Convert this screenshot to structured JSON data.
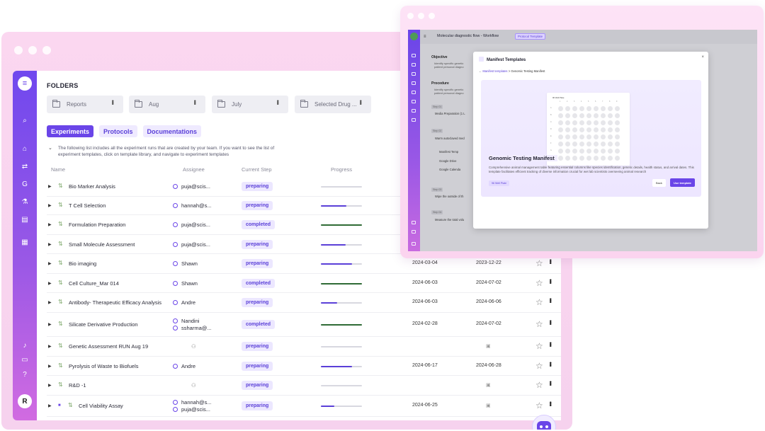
{
  "main": {
    "folders_title": "FOLDERS",
    "folders": [
      "Reports",
      "Aug",
      "July",
      "Selected Drug ..."
    ],
    "tabs": [
      "Experiments",
      "Protocols",
      "Documentations"
    ],
    "info_text": "The following list includes all the experiment runs that are created by your team. If you want to see the list of experiment templates, click on template library, and navigate to experiment templates",
    "columns": {
      "name": "Name",
      "assignee": "Assignee",
      "current_step": "Current Step",
      "progress": "Progress"
    },
    "rows": [
      {
        "name": "Bio Marker Analysis",
        "assignee": "puja@scis...",
        "step": "preparing",
        "progress": 0,
        "d1": "",
        "d2": ""
      },
      {
        "name": "T Cell Selection",
        "assignee": "hannah@s...",
        "step": "preparing",
        "progress": 0.62,
        "d1": "",
        "d2": ""
      },
      {
        "name": "Formulation Preparation",
        "assignee": "puja@scis...",
        "step": "completed",
        "progress": 1,
        "d1": "",
        "d2": ""
      },
      {
        "name": "Small Molecule Assessment",
        "assignee": "puja@scis...",
        "step": "preparing",
        "progress": 0.6,
        "d1": "",
        "d2": ""
      },
      {
        "name": "Bio imaging",
        "assignee": "Shawn",
        "step": "preparing",
        "progress": 0.75,
        "d1": "2024-03-04",
        "d2": "2023-12-22"
      },
      {
        "name": "Cell Culture_Mar 014",
        "assignee": "Shawn",
        "step": "completed",
        "progress": 1,
        "d1": "2024-06-03",
        "d2": "2024-07-02"
      },
      {
        "name": "Antibody- Therapeutic Efficacy Analysis",
        "assignee": "Andre",
        "step": "preparing",
        "progress": 0.4,
        "d1": "2024-06-03",
        "d2": "2024-06-06"
      },
      {
        "name": "Silicate Derivative Production",
        "assignee": "Nandini",
        "assignee2": "ssharma@...",
        "step": "completed",
        "progress": 1,
        "d1": "2024-02-28",
        "d2": "2024-07-02"
      },
      {
        "name": "Genetic Assessment RUN Aug 19",
        "assignee": "",
        "step": "preparing",
        "progress": 0,
        "d1": "",
        "d2": ""
      },
      {
        "name": "Pyrolysis of Waste to Biofuels",
        "assignee": "Andre",
        "step": "preparing",
        "progress": 0.75,
        "d1": "2024-06-17",
        "d2": "2024-06-28"
      },
      {
        "name": "R&D -1",
        "assignee": "",
        "step": "preparing",
        "progress": 0,
        "d1": "",
        "d2": ""
      },
      {
        "name": "Cell Viability Assay",
        "assignee": "hannah@s...",
        "assignee2": "puja@scis...",
        "step": "preparing",
        "progress": 0.33,
        "d1": "2024-06-25",
        "d2": ""
      }
    ],
    "rail_avatar": "R"
  },
  "workflow": {
    "title": "Molecular diagnostic flow - Workflow",
    "badge": "Protocol Template",
    "sections": {
      "objective": "Objective",
      "procedure": "Procedure"
    },
    "objective_text": "Identify specific genetic patient personal diagno",
    "procedure_text": "Identify specific genetic patient personal diagno",
    "steps": [
      "Step 01",
      "Step 02",
      "Step 03",
      "Step 04"
    ],
    "items": [
      "Media Preparation (1 L",
      "Warm autoclaved med",
      "Manifest Temp",
      "Google Drive",
      "Google Calenda",
      "Wipe the outside of th",
      "Measure the total volu"
    ],
    "modal": {
      "title": "Manifest Templates",
      "close": "×",
      "crumb_link": "Manifest templates",
      "crumb_sep": ">",
      "crumb_current": "Genomic Testing Manifest",
      "plate_title": "96 Well Plate",
      "plate_cols": [
        "1",
        "2",
        "3",
        "4",
        "5",
        "6",
        "7",
        "8",
        "9",
        "10",
        "11",
        "12"
      ],
      "plate_rows": [
        "A",
        "B",
        "C",
        "D",
        "E",
        "F",
        "G",
        "H"
      ],
      "heading": "Genomic Testing Manifest",
      "description": "Comprehensive animal management table featuring essential columns like species identification, genetic details, health status, and arrival dates. This template facilitates efficient tracking of diverse information crucial for wet lab scientists overseeing animal research",
      "tag": "96 Well Plate",
      "back_label": "Back",
      "use_label": "Use template"
    }
  },
  "colors": {
    "accent": "#6a45e8",
    "completed": "#2f6b35",
    "window_bg": "#fbd7f0"
  },
  "icons": [
    "menu-icon",
    "search-icon",
    "home-icon",
    "flow-icon",
    "g-icon",
    "flask-icon",
    "document-icon",
    "grid-icon",
    "bell-icon",
    "chat-icon",
    "help-icon",
    "folder-icon",
    "kebab-icon",
    "star-icon",
    "calendar-icon",
    "user-icon",
    "bot-icon"
  ]
}
